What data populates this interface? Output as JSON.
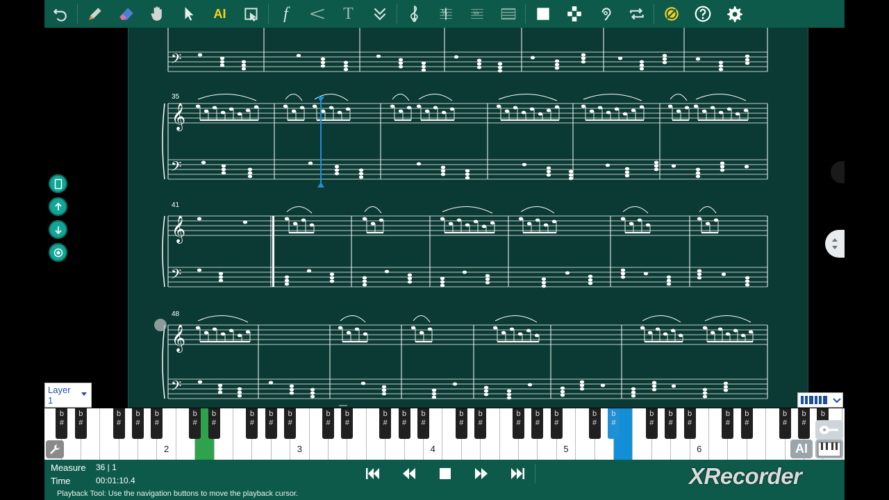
{
  "toolbar": {
    "ai_label": "AI",
    "dynamics_label": "f",
    "text_label": "T",
    "icons": [
      "undo-icon",
      "pencil-icon",
      "eraser-icon",
      "hand-icon",
      "arrow-cursor-icon",
      "ai-icon",
      "select-box-icon",
      "dynamics-icon",
      "hairpin-icon",
      "text-icon",
      "chevron-double-down-icon",
      "treble-clef-icon",
      "tempo-icon",
      "accidentals-icon",
      "staff-lines-icon",
      "square-icon",
      "checker-icon",
      "listen-icon",
      "repeat-icon",
      "disable-icon",
      "help-icon",
      "gear-icon"
    ]
  },
  "score": {
    "measure_numbers": [
      "35",
      "41",
      "48"
    ],
    "colors": {
      "background": "#0a3a33",
      "ink": "#ffffff",
      "cursor": "#1f8fd6"
    }
  },
  "side_buttons": [
    "tablet-icon",
    "arrow-up-icon",
    "arrow-down-icon",
    "target-icon"
  ],
  "layer": {
    "label": "Layer",
    "value": "1"
  },
  "piano": {
    "octave_labels": [
      "2",
      "3",
      "4",
      "5",
      "6"
    ],
    "black_key_label": "b\n#",
    "highlighted": {
      "green_key": "G2",
      "blue_key": "A#4"
    }
  },
  "status": {
    "measure_label": "Measure",
    "measure_value": "36 | 1",
    "time_label": "Time",
    "time_value": "00:01:10.4"
  },
  "transport": [
    "skip-back-icon",
    "rewind-icon",
    "stop-icon",
    "fast-forward-icon",
    "skip-forward-icon"
  ],
  "hint": "Playback Tool: Use the navigation buttons to move the playback cursor.",
  "watermark": "XRecorder",
  "ai_button": "AI"
}
